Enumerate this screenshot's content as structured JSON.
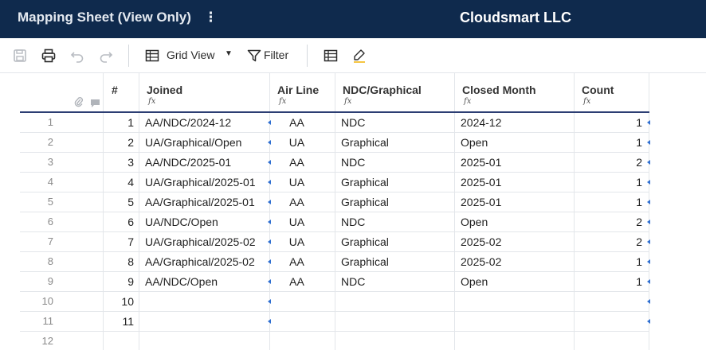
{
  "header": {
    "sheet_title": "Mapping Sheet (View Only)",
    "menu_glyph": "⋮",
    "org_name": "Cloudsmart LLC"
  },
  "toolbar": {
    "icons": [
      "save-icon",
      "print-icon",
      "undo-icon",
      "redo-icon",
      "grid-view-icon",
      "filter-icon",
      "grid-settings-icon",
      "highlight-icon"
    ],
    "grid_view_label": "Grid View",
    "filter_label": "Filter",
    "caret": "▼"
  },
  "columns": [
    {
      "key": "row_index",
      "label": "#"
    },
    {
      "key": "joined",
      "label": "Joined",
      "formula": "fx"
    },
    {
      "key": "air_line",
      "label": "Air Line",
      "formula": "fx"
    },
    {
      "key": "ndc_graphical",
      "label": "NDC/Graphical",
      "formula": "fx"
    },
    {
      "key": "closed_month",
      "label": "Closed Month",
      "formula": "fx"
    },
    {
      "key": "count",
      "label": "Count",
      "formula": "fx"
    }
  ],
  "rows": [
    {
      "num": "1",
      "idx": "1",
      "joined": "AA/NDC/2024-12",
      "air_line": "AA",
      "ndc_graphical": "NDC",
      "closed_month": "2024-12",
      "count": "1"
    },
    {
      "num": "2",
      "idx": "2",
      "joined": "UA/Graphical/Open",
      "air_line": "UA",
      "ndc_graphical": "Graphical",
      "closed_month": "Open",
      "count": "1"
    },
    {
      "num": "3",
      "idx": "3",
      "joined": "AA/NDC/2025-01",
      "air_line": "AA",
      "ndc_graphical": "NDC",
      "closed_month": "2025-01",
      "count": "2"
    },
    {
      "num": "4",
      "idx": "4",
      "joined": "UA/Graphical/2025-01",
      "air_line": "UA",
      "ndc_graphical": "Graphical",
      "closed_month": "2025-01",
      "count": "1"
    },
    {
      "num": "5",
      "idx": "5",
      "joined": "AA/Graphical/2025-01",
      "air_line": "AA",
      "ndc_graphical": "Graphical",
      "closed_month": "2025-01",
      "count": "1"
    },
    {
      "num": "6",
      "idx": "6",
      "joined": "UA/NDC/Open",
      "air_line": "UA",
      "ndc_graphical": "NDC",
      "closed_month": "Open",
      "count": "2"
    },
    {
      "num": "7",
      "idx": "7",
      "joined": "UA/Graphical/2025-02",
      "air_line": "UA",
      "ndc_graphical": "Graphical",
      "closed_month": "2025-02",
      "count": "2"
    },
    {
      "num": "8",
      "idx": "8",
      "joined": "AA/Graphical/2025-02",
      "air_line": "AA",
      "ndc_graphical": "Graphical",
      "closed_month": "2025-02",
      "count": "1"
    },
    {
      "num": "9",
      "idx": "9",
      "joined": "AA/NDC/Open",
      "air_line": "AA",
      "ndc_graphical": "NDC",
      "closed_month": "Open",
      "count": "1"
    },
    {
      "num": "10",
      "idx": "10",
      "joined": "",
      "air_line": "",
      "ndc_graphical": "",
      "closed_month": "",
      "count": ""
    },
    {
      "num": "11",
      "idx": "11",
      "joined": "",
      "air_line": "",
      "ndc_graphical": "",
      "closed_month": "",
      "count": ""
    },
    {
      "num": "12",
      "idx": "",
      "joined": "",
      "air_line": "",
      "ndc_graphical": "",
      "closed_month": "",
      "count": ""
    }
  ],
  "colors": {
    "header_bg": "#0f2a4d",
    "accent_marker": "#2f6fd1",
    "header_underline": "#2c3e73"
  }
}
